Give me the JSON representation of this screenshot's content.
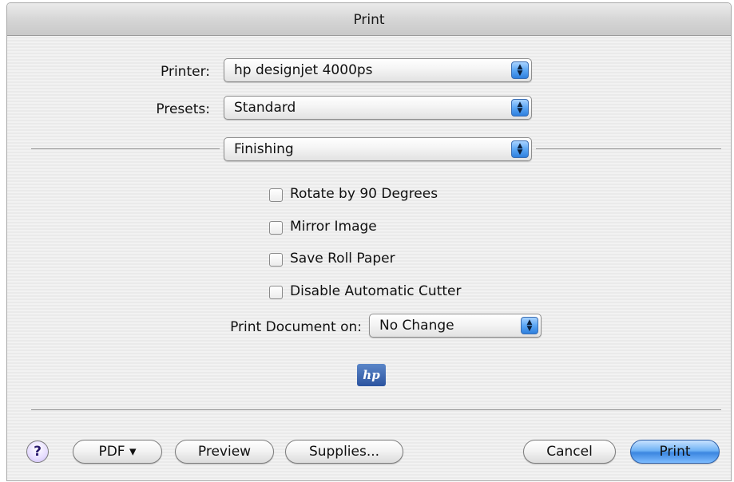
{
  "window": {
    "title": "Print"
  },
  "printer": {
    "label": "Printer:",
    "value": "hp designjet 4000ps"
  },
  "presets": {
    "label": "Presets:",
    "value": "Standard"
  },
  "panel": {
    "value": "Finishing"
  },
  "options": [
    {
      "label": "Rotate by 90 Degrees",
      "checked": false
    },
    {
      "label": "Mirror Image",
      "checked": false
    },
    {
      "label": "Save Roll Paper",
      "checked": false
    },
    {
      "label": "Disable Automatic Cutter",
      "checked": false
    }
  ],
  "print_document_on": {
    "label": "Print Document on:",
    "value": "No Change"
  },
  "logo": {
    "text": "hp"
  },
  "buttons": {
    "help": "?",
    "pdf": "PDF ▾",
    "preview": "Preview",
    "supplies": "Supplies...",
    "cancel": "Cancel",
    "print": "Print"
  },
  "colors": {
    "accent": "#3b86e0",
    "hp_blue": "#2c54a0"
  },
  "icons": {
    "popup_arrows": "up-down-arrows-icon",
    "help": "question-mark-icon",
    "logo": "hp-logo-icon"
  }
}
